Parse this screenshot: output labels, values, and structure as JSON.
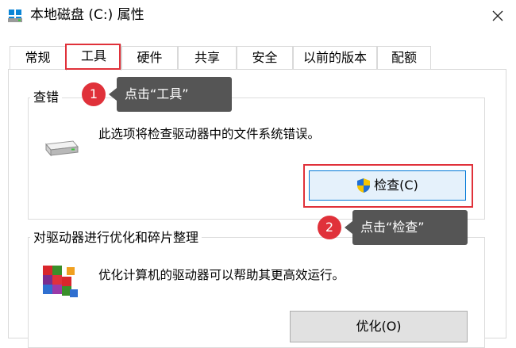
{
  "window": {
    "title": "本地磁盘 (C:) 属性"
  },
  "tabs": [
    {
      "label": "常规"
    },
    {
      "label": "工具"
    },
    {
      "label": "硬件"
    },
    {
      "label": "共享"
    },
    {
      "label": "安全"
    },
    {
      "label": "以前的版本"
    },
    {
      "label": "配额"
    }
  ],
  "active_tab": "工具",
  "check_section": {
    "title": "查错",
    "description": "此选项将检查驱动器中的文件系统错误。",
    "button_label": "检查(C)"
  },
  "optimize_section": {
    "title": "对驱动器进行优化和碎片整理",
    "description": "优化计算机的驱动器可以帮助其更高效运行。",
    "button_label": "优化(O)"
  },
  "annotations": [
    {
      "number": "1",
      "text": "点击“工具”"
    },
    {
      "number": "2",
      "text": "点击“检查”"
    }
  ],
  "colors": {
    "highlight": "#e0313a",
    "callout_bg": "#555555",
    "button_focus": "#0078d7"
  }
}
